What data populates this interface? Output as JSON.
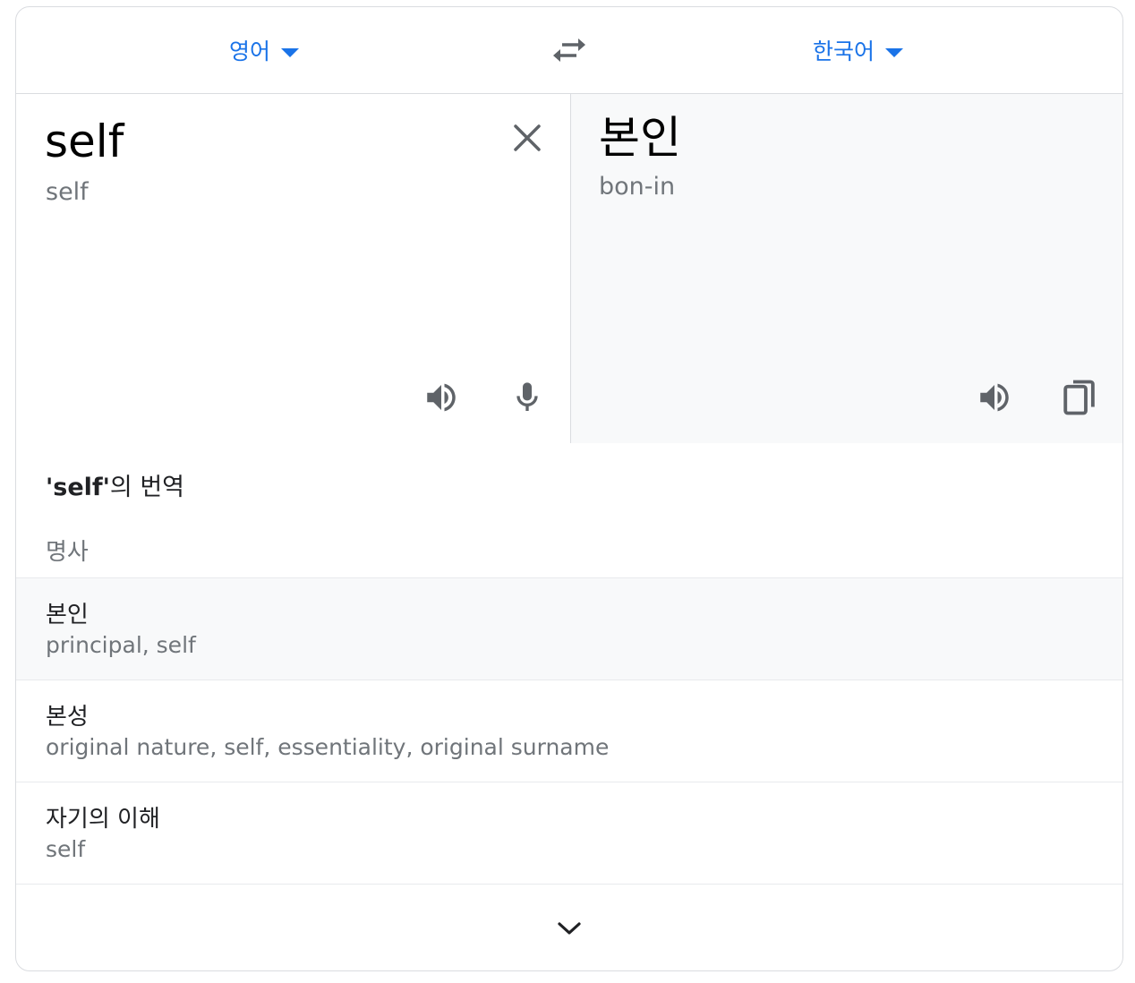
{
  "language_bar": {
    "source_language": "영어",
    "target_language": "한국어",
    "swap_icon": "swap-horiz-icon",
    "accent_color": "#1a73e8"
  },
  "source_pane": {
    "text": "self",
    "transliteration": "self",
    "icons": [
      "close-icon",
      "speaker-icon",
      "microphone-icon"
    ]
  },
  "target_pane": {
    "text": "본인",
    "romanization": "bon-in",
    "icons": [
      "speaker-icon",
      "copy-icon"
    ]
  },
  "dictionary": {
    "title_term": "'self'",
    "title_suffix": "의 번역",
    "part_of_speech": "명사",
    "entries": [
      {
        "word": "본인",
        "gloss": "principal, self"
      },
      {
        "word": "본성",
        "gloss": "original nature, self, essentiality, original surname"
      },
      {
        "word": "자기의 이해",
        "gloss": "self"
      }
    ],
    "expand_icon": "chevron-down-icon"
  }
}
